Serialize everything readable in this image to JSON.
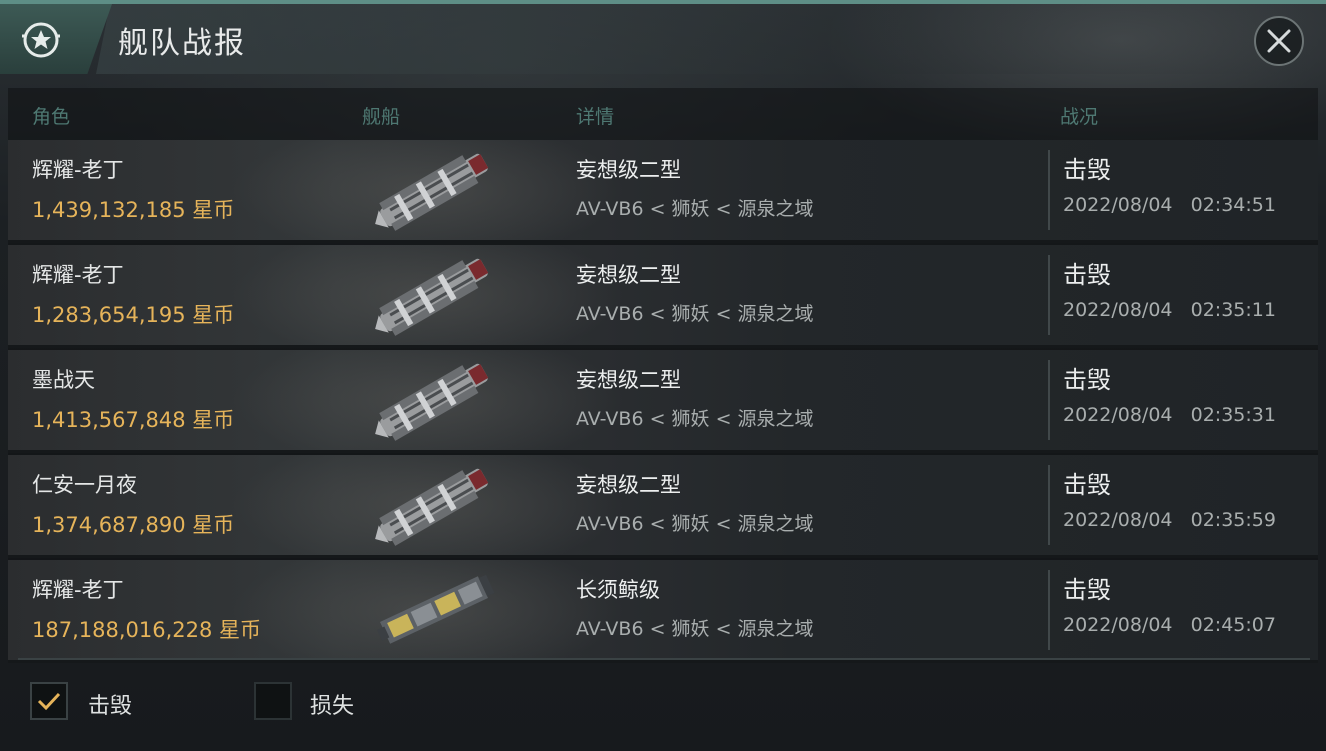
{
  "header": {
    "title": "舰队战报",
    "icon": "star-medal-icon",
    "close_icon": "close-icon"
  },
  "columns": {
    "role": "角色",
    "ship": "舰船",
    "details": "详情",
    "status": "战况"
  },
  "rows": [
    {
      "name": "辉耀-老丁",
      "value": "1,439,132,185 星币",
      "ship_name": "妄想级二型",
      "location": "AV-VB6 < 狮妖 < 源泉之域",
      "status": "击毁",
      "time": "2022/08/04   02:34:51",
      "ship_icon": "battleship-icon"
    },
    {
      "name": "辉耀-老丁",
      "value": "1,283,654,195 星币",
      "ship_name": "妄想级二型",
      "location": "AV-VB6 < 狮妖 < 源泉之域",
      "status": "击毁",
      "time": "2022/08/04   02:35:11",
      "ship_icon": "battleship-icon"
    },
    {
      "name": "墨战天",
      "value": "1,413,567,848 星币",
      "ship_name": "妄想级二型",
      "location": "AV-VB6 < 狮妖 < 源泉之域",
      "status": "击毁",
      "time": "2022/08/04   02:35:31",
      "ship_icon": "battleship-icon"
    },
    {
      "name": "仁安一月夜",
      "value": "1,374,687,890 星币",
      "ship_name": "妄想级二型",
      "location": "AV-VB6 < 狮妖 < 源泉之域",
      "status": "击毁",
      "time": "2022/08/04   02:35:59",
      "ship_icon": "battleship-icon"
    },
    {
      "name": "辉耀-老丁",
      "value": "187,188,016,228 星币",
      "ship_name": "长须鲸级",
      "location": "AV-VB6 < 狮妖 < 源泉之域",
      "status": "击毁",
      "time": "2022/08/04   02:45:07",
      "ship_icon": "freighter-icon"
    }
  ],
  "filters": [
    {
      "label": "击毁",
      "checked": true
    },
    {
      "label": "损失",
      "checked": false
    }
  ],
  "colors": {
    "accent": "#5e8e86",
    "value": "#e6b45a",
    "check": "#e6b45a"
  }
}
